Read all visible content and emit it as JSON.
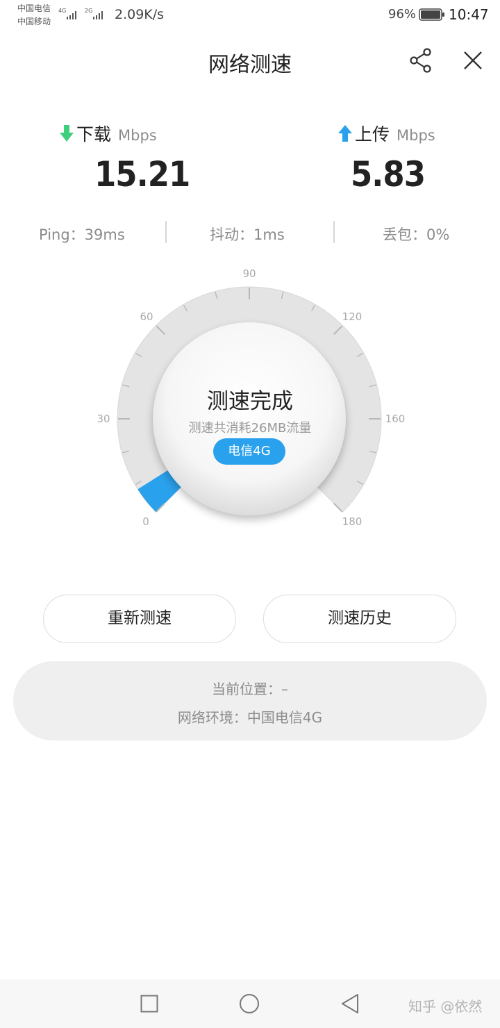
{
  "status_bar": {
    "carrier_1": "中国电信",
    "carrier_2": "中国移动",
    "net_1": "4G",
    "net_2": "2G",
    "speed": "2.09K/s",
    "battery": "96%",
    "time": "10:47"
  },
  "header": {
    "title": "网络测速",
    "share_icon": "share-icon",
    "close_icon": "close-icon"
  },
  "download": {
    "label": "下载",
    "unit": "Mbps",
    "value": "15.21",
    "color": "#3ecf7e"
  },
  "upload": {
    "label": "上传",
    "unit": "Mbps",
    "value": "5.83",
    "color": "#2aa1ec"
  },
  "stats": {
    "ping": "Ping：39ms",
    "jitter": "抖动：1ms",
    "loss": "丢包：0%"
  },
  "gauge": {
    "scale_labels": [
      "0",
      "30",
      "60",
      "90",
      "120",
      "160",
      "180"
    ],
    "progress_value": 5.83,
    "status": "测速完成",
    "usage": "测速共消耗26MB流量",
    "network_badge": "电信4G",
    "accent": "#2aa1ec"
  },
  "actions": {
    "retest": "重新测速",
    "history": "测速历史"
  },
  "info": {
    "location": "当前位置：–",
    "environment": "网络环境：中国电信4G"
  },
  "navbar": {
    "square_icon": "recent-apps-icon",
    "circle_icon": "home-icon",
    "triangle_icon": "back-icon"
  },
  "watermark": "知乎 @依然"
}
